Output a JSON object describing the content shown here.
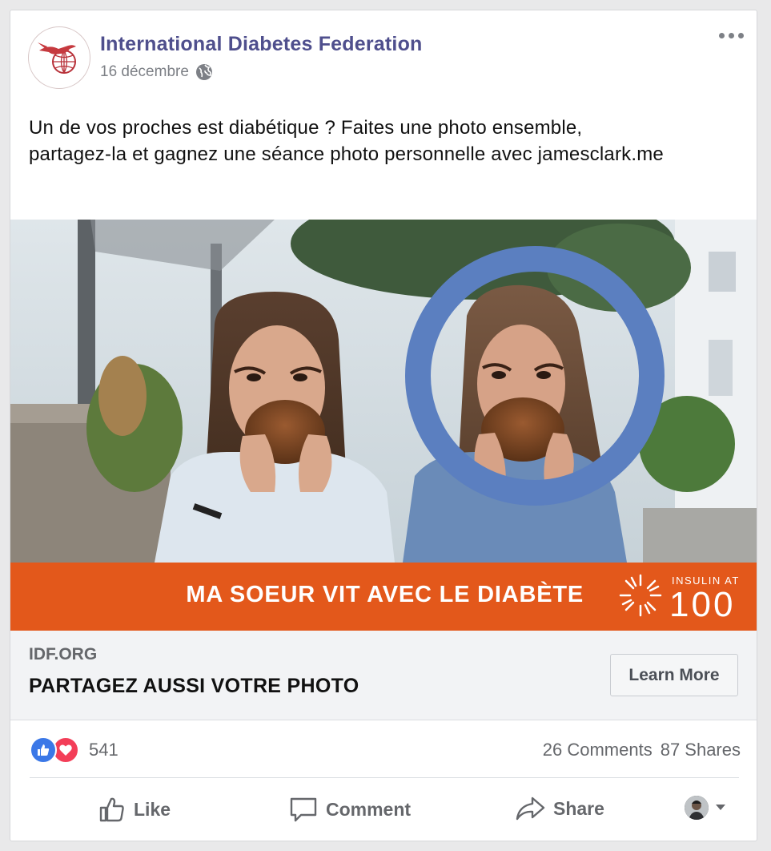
{
  "post": {
    "page_name": "International Diabetes Federation",
    "date": "16 décembre",
    "text_line1": "Un de vos proches est diabétique ? Faites une photo ensemble,",
    "text_line2": "partagez-la et gagnez une séance photo personnelle avec jamesclark.me"
  },
  "ad": {
    "banner_text": "MA SOEUR VIT AVEC LE DIABÈTE",
    "logo_small": "INSULIN AT",
    "logo_big": "100",
    "banner_color": "#e3581b",
    "ring_color": "#5b7fc0"
  },
  "link": {
    "domain": "IDF.ORG",
    "headline": "PARTAGEZ AUSSI VOTRE PHOTO",
    "cta": "Learn More"
  },
  "stats": {
    "reactions": "541",
    "comments": "26 Comments",
    "shares": "87 Shares"
  },
  "actions": {
    "like": "Like",
    "comment": "Comment",
    "share": "Share"
  },
  "icons": [
    "hummingbird-globe-logo",
    "globe-icon",
    "more-icon",
    "like-reaction-icon",
    "love-reaction-icon",
    "thumbs-up-icon",
    "comment-icon",
    "share-icon",
    "profile-avatar",
    "caret-down-icon",
    "insulin-sun-icon"
  ]
}
